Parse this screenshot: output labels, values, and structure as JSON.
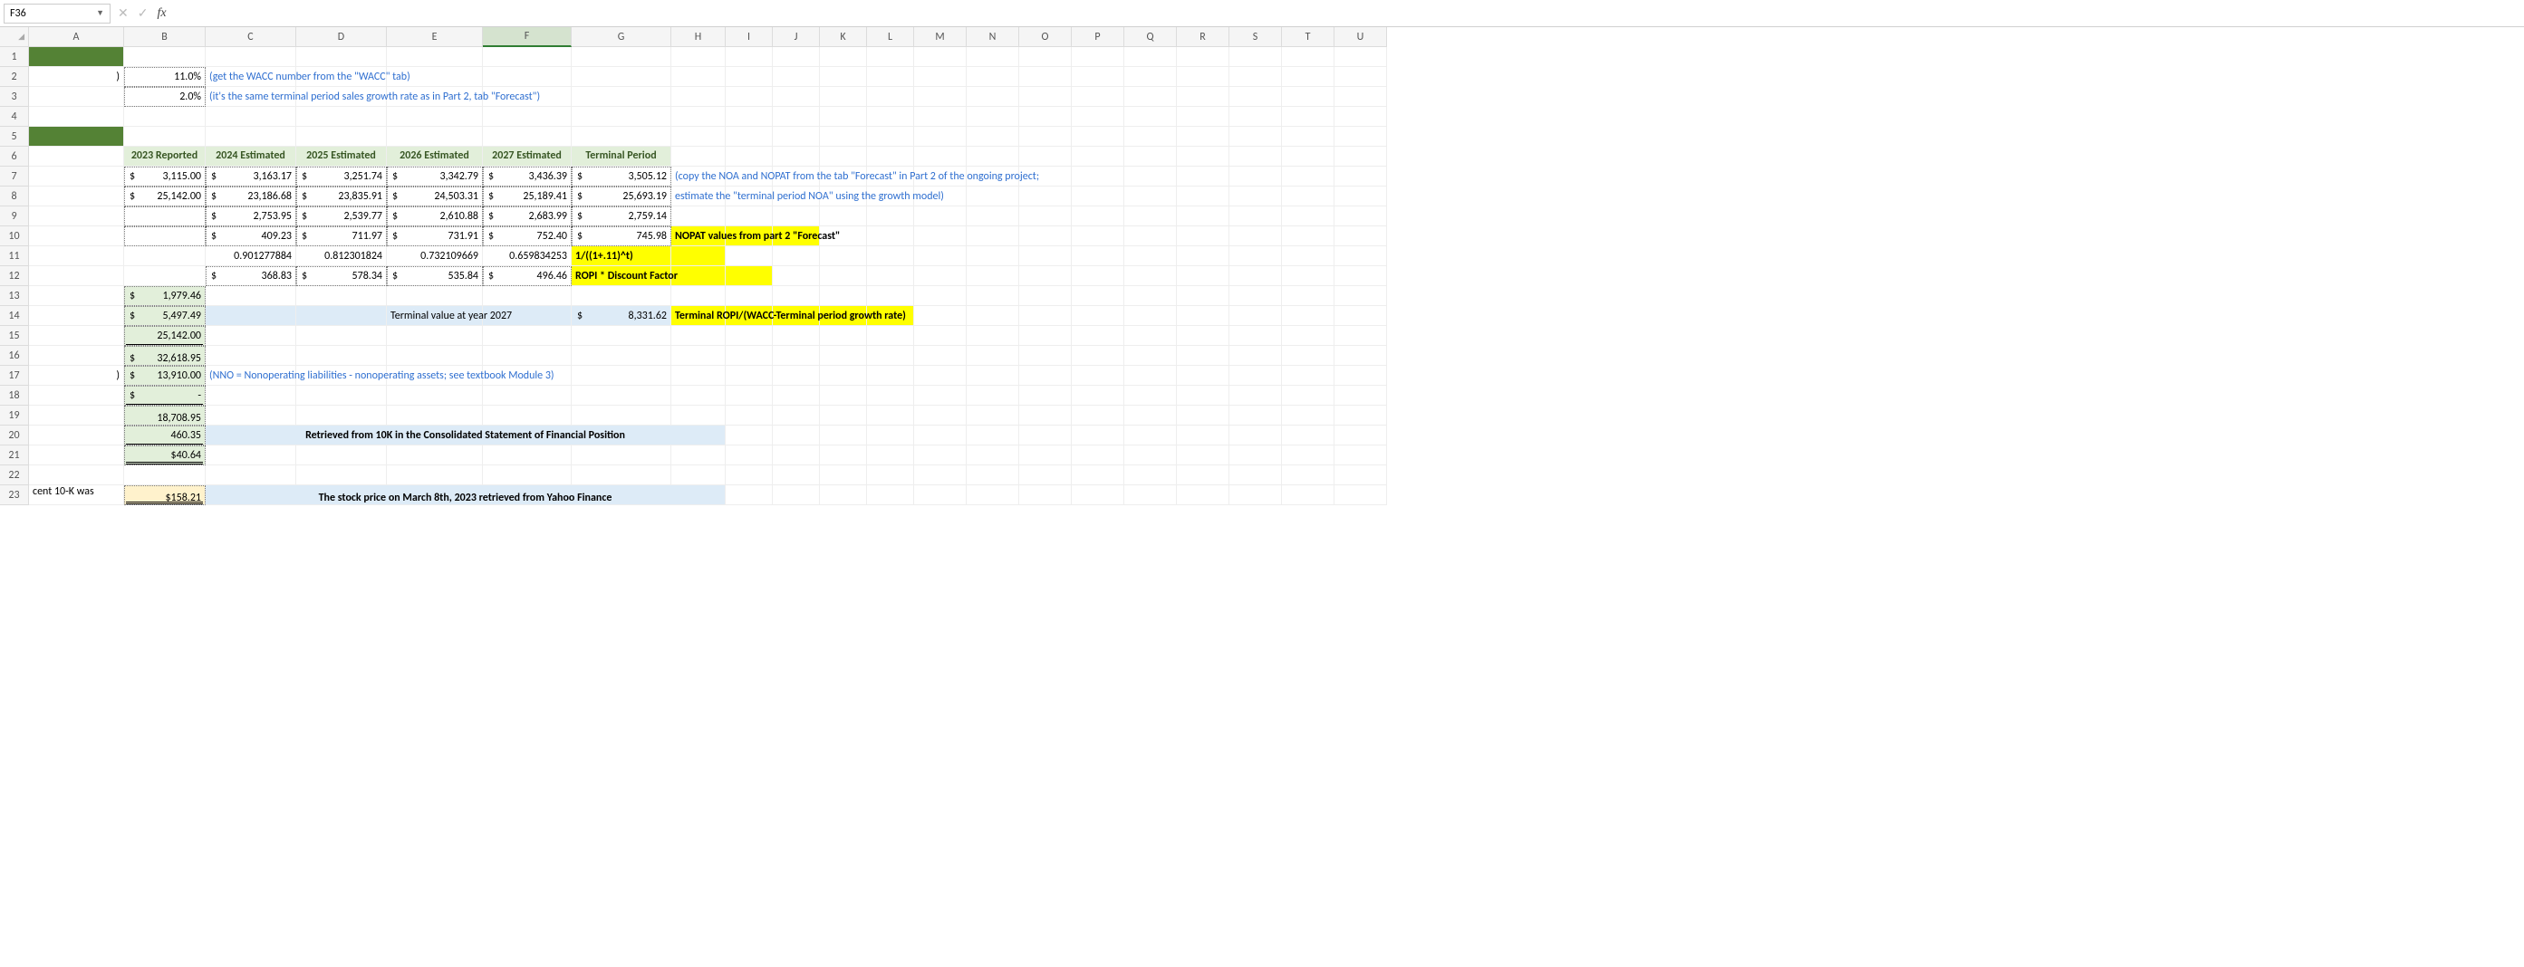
{
  "namebox": {
    "value": "F36"
  },
  "formula_bar": {
    "value": "",
    "cancel_icon": "✕",
    "enter_icon": "✓",
    "fx_label": "fx"
  },
  "columns": [
    "A",
    "B",
    "C",
    "D",
    "E",
    "F",
    "G",
    "H",
    "I",
    "J",
    "K",
    "L",
    "M",
    "N",
    "O",
    "P",
    "Q",
    "R",
    "S",
    "T",
    "U"
  ],
  "row2": {
    "A": ")",
    "B": "11.0%",
    "note": "(get the WACC number from the \"WACC\" tab)"
  },
  "row3": {
    "B": "2.0%",
    "note": "(it's the same terminal period sales growth rate as in Part 2, tab \"Forecast\")"
  },
  "headers": {
    "B": "2023 Reported",
    "C": "2024 Estimated",
    "D": "2025 Estimated",
    "E": "2026 Estimated",
    "F": "2027 Estimated",
    "G": "Terminal Period"
  },
  "row7": {
    "B": "3,115.00",
    "C": "3,163.17",
    "D": "3,251.74",
    "E": "3,342.79",
    "F": "3,436.39",
    "G": "3,505.12",
    "note": "(copy the NOA and NOPAT from the tab \"Forecast\" in Part 2 of the ongoing project;"
  },
  "row8": {
    "B": "25,142.00",
    "C": "23,186.68",
    "D": "23,835.91",
    "E": "24,503.31",
    "F": "25,189.41",
    "G": "25,693.19",
    "note": "estimate the \"terminal period NOA\" using the growth model)"
  },
  "row9": {
    "C": "2,753.95",
    "D": "2,539.77",
    "E": "2,610.88",
    "F": "2,683.99",
    "G": "2,759.14"
  },
  "row10": {
    "C": "409.23",
    "D": "711.97",
    "E": "731.91",
    "F": "752.40",
    "G": "745.98",
    "note": "NOPAT values from part 2 \"Forecast\""
  },
  "row11": {
    "C": "0.901277884",
    "D": "0.812301824",
    "E": "0.732109669",
    "F": "0.659834253",
    "note": "1/((1+.11)^t)"
  },
  "row12": {
    "C": "368.83",
    "D": "578.34",
    "E": "535.84",
    "F": "496.46",
    "note": "ROPI * Discount Factor"
  },
  "row13": {
    "B": "1,979.46"
  },
  "row14": {
    "B": "5,497.49",
    "E": "Terminal value at year 2027",
    "G": "8,331.62",
    "note": "Terminal ROPI/(WACC-Terminal period growth rate)"
  },
  "row15": {
    "B": "25,142.00"
  },
  "row16": {
    "B": "32,618.95"
  },
  "row17": {
    "A": ")",
    "B": "13,910.00",
    "note": "(NNO = Nonoperating liabilities - nonoperating assets; see textbook Module 3)"
  },
  "row18": {
    "B": "-"
  },
  "row19": {
    "B": "18,708.95"
  },
  "row20": {
    "B": "460.35",
    "note": "Retrieved from 10K in the Consolidated Statement of Financial Position"
  },
  "row21": {
    "B": "$40.64"
  },
  "row23": {
    "A": "cent 10-K was",
    "B": "$158.21",
    "note": "The stock price on March 8th, 2023 retrieved from Yahoo Finance"
  },
  "chart_data": {
    "type": "table",
    "title": "ROPI valuation worksheet",
    "wacc": 0.11,
    "terminal_growth": 0.02,
    "columns": [
      "2023 Reported",
      "2024 Estimated",
      "2025 Estimated",
      "2026 Estimated",
      "2027 Estimated",
      "Terminal Period"
    ],
    "nopat": [
      3115.0,
      3163.17,
      3251.74,
      3342.79,
      3436.39,
      3505.12
    ],
    "noa": [
      25142.0,
      23186.68,
      23835.91,
      24503.31,
      25189.41,
      25693.19
    ],
    "required_return_noa": [
      null,
      2753.95,
      2539.77,
      2610.88,
      2683.99,
      2759.14
    ],
    "ropi": [
      null,
      409.23,
      711.97,
      731.91,
      752.4,
      745.98
    ],
    "discount_factor": [
      null,
      0.901277884,
      0.812301824,
      0.732109669,
      0.659834253,
      null
    ],
    "pv_ropi": [
      null,
      368.83,
      578.34,
      535.84,
      496.46,
      null
    ],
    "sum_pv_ropi": 1979.46,
    "pv_terminal_ropi": 5497.49,
    "terminal_value_2027": 8331.62,
    "noa_base": 25142.0,
    "firm_value": 32618.95,
    "nno": 13910.0,
    "preferred": 0,
    "equity_value": 18708.95,
    "shares_outstanding_millions": 460.35,
    "value_per_share": 40.64,
    "stock_price_mar8_2023": 158.21
  }
}
